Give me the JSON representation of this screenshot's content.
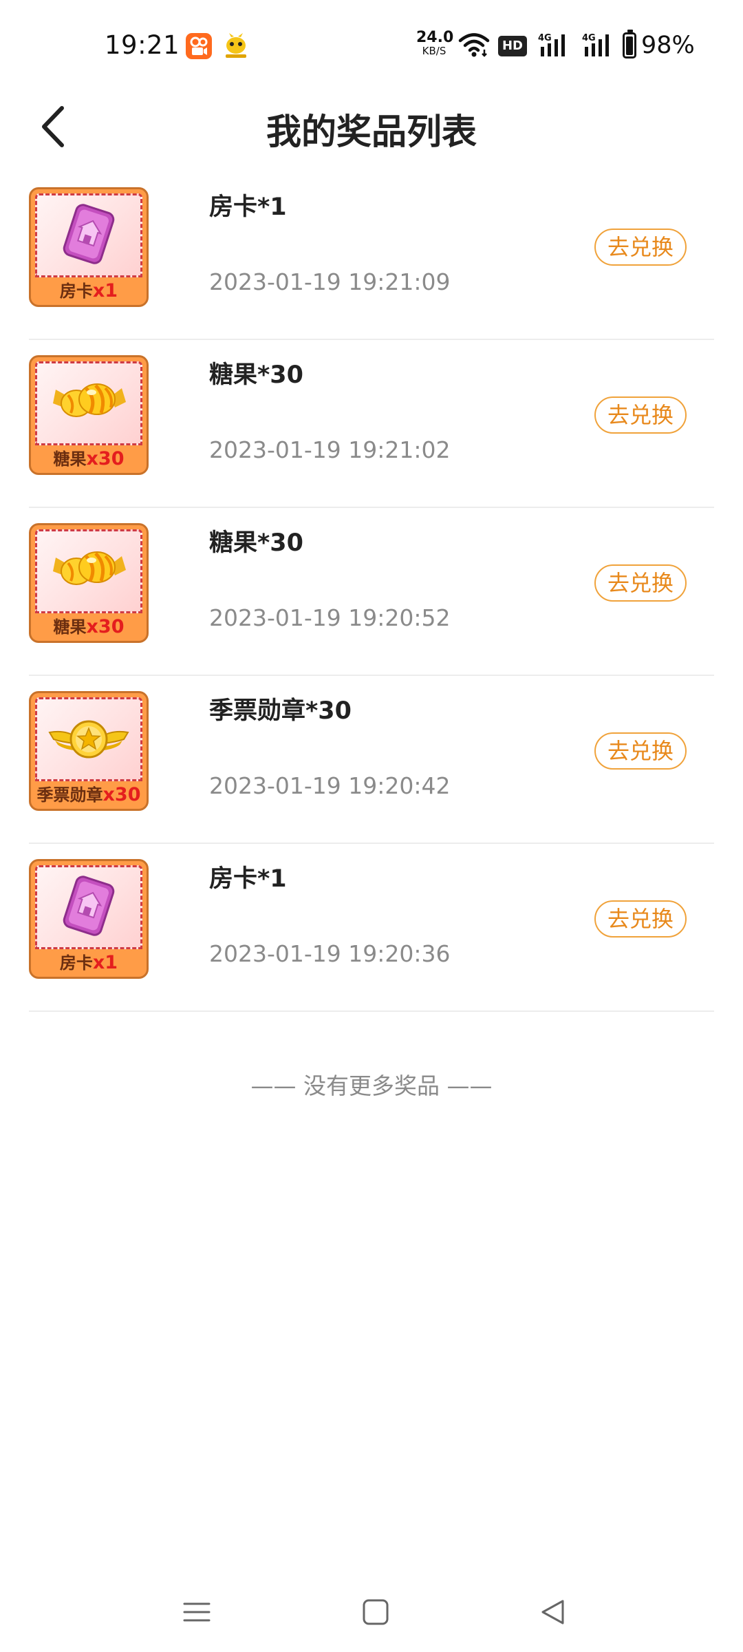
{
  "status_bar": {
    "time": "19:21",
    "net_speed_value": "24.0",
    "net_speed_unit": "KB/S",
    "hd_label": "HD",
    "signal1_label": "4G",
    "signal2_label": "4G",
    "battery_percent": "98%",
    "battery_level": 0.98
  },
  "header": {
    "title": "我的奖品列表"
  },
  "prizes": [
    {
      "name": "房卡*1",
      "time": "2023-01-19 19:21:09",
      "thumb_label": "房卡",
      "thumb_qty": "x1",
      "icon": "room-card-icon",
      "redeem_label": "去兑换"
    },
    {
      "name": "糖果*30",
      "time": "2023-01-19 19:21:02",
      "thumb_label": "糖果",
      "thumb_qty": "x30",
      "icon": "candy-icon",
      "redeem_label": "去兑换"
    },
    {
      "name": "糖果*30",
      "time": "2023-01-19 19:20:52",
      "thumb_label": "糖果",
      "thumb_qty": "x30",
      "icon": "candy-icon",
      "redeem_label": "去兑换"
    },
    {
      "name": "季票勋章*30",
      "time": "2023-01-19 19:20:42",
      "thumb_label": "季票勋章",
      "thumb_qty": "x30",
      "icon": "winged-star-medal-icon",
      "redeem_label": "去兑换"
    },
    {
      "name": "房卡*1",
      "time": "2023-01-19 19:20:36",
      "thumb_label": "房卡",
      "thumb_qty": "x1",
      "icon": "room-card-icon",
      "redeem_label": "去兑换"
    }
  ],
  "footer": {
    "no_more_text": "—— 没有更多奖品 ——"
  },
  "colors": {
    "accent": "#e8891c",
    "accent_border": "#f0a23a",
    "muted_text": "#8a8a8a",
    "divider": "#ececec"
  }
}
